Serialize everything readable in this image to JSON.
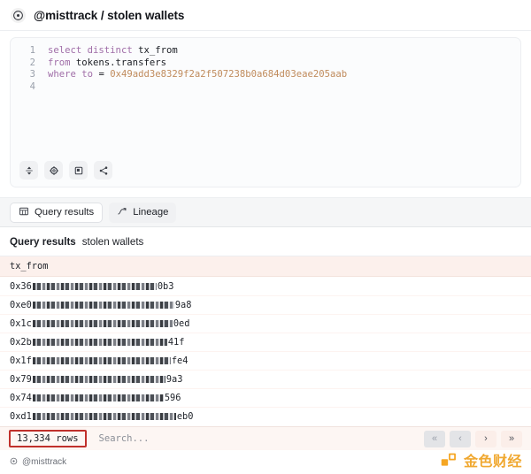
{
  "header": {
    "icon": "target-circle-icon",
    "title": "@misttrack / stolen wallets"
  },
  "editor": {
    "lines": [
      {
        "num": "1",
        "tokens": [
          {
            "t": "select",
            "c": "kw"
          },
          {
            "t": " ",
            "c": "plain"
          },
          {
            "t": "distinct",
            "c": "kw"
          },
          {
            "t": " ",
            "c": "plain"
          },
          {
            "t": "tx_from",
            "c": "ident"
          }
        ]
      },
      {
        "num": "2",
        "tokens": [
          {
            "t": "from",
            "c": "kw"
          },
          {
            "t": " ",
            "c": "plain"
          },
          {
            "t": "tokens.transfers",
            "c": "ident"
          }
        ]
      },
      {
        "num": "3",
        "tokens": [
          {
            "t": "where",
            "c": "kw"
          },
          {
            "t": " ",
            "c": "plain"
          },
          {
            "t": "to",
            "c": "kw"
          },
          {
            "t": " ",
            "c": "plain"
          },
          {
            "t": "=",
            "c": "ident"
          },
          {
            "t": " ",
            "c": "plain"
          },
          {
            "t": "0x49add3e8329f2a2f507238b0a684d03eae205aab",
            "c": "lit"
          }
        ]
      },
      {
        "num": "4",
        "tokens": []
      }
    ],
    "query_text": "select distinct tx_from\nfrom tokens.transfers\nwhere to = 0x49add3e8329f2a2f507238b0a684d03eae205aab",
    "toolbar": [
      {
        "name": "expand-collapse-icon",
        "label": "Expand / collapse"
      },
      {
        "name": "gear-icon",
        "label": "Settings"
      },
      {
        "name": "note-icon",
        "label": "Format / notes"
      },
      {
        "name": "share-icon",
        "label": "Share"
      }
    ]
  },
  "tabs": [
    {
      "label": "Query results",
      "icon": "table-icon",
      "active": true
    },
    {
      "label": "Lineage",
      "icon": "lineage-icon",
      "active": false
    }
  ],
  "results": {
    "title": "Query results",
    "subtitle": "stolen wallets",
    "column_header": "tx_from",
    "rows": [
      {
        "prefix": "0x36",
        "redacted_width": 140,
        "suffix": "0b3"
      },
      {
        "prefix": "0xe0",
        "redacted_width": 160,
        "suffix": "9a8"
      },
      {
        "prefix": "0x1c",
        "redacted_width": 158,
        "suffix": "0ed"
      },
      {
        "prefix": "0x2b",
        "redacted_width": 152,
        "suffix": "41f"
      },
      {
        "prefix": "0x1f",
        "redacted_width": 156,
        "suffix": "fe4"
      },
      {
        "prefix": "0x79",
        "redacted_width": 150,
        "suffix": "9a3"
      },
      {
        "prefix": "0x74",
        "redacted_width": 148,
        "suffix": "596"
      },
      {
        "prefix": "0xd1",
        "redacted_width": 162,
        "suffix": "eb0"
      }
    ]
  },
  "footer": {
    "rows_count": "13,334 rows",
    "search_placeholder": "Search...",
    "pagination": [
      {
        "glyph": "«",
        "name": "first-page-button",
        "state": "disabled"
      },
      {
        "glyph": "‹",
        "name": "prev-page-button",
        "state": "disabled"
      },
      {
        "glyph": "›",
        "name": "next-page-button",
        "state": "enabled"
      },
      {
        "glyph": "»",
        "name": "last-page-button",
        "state": "enabled"
      }
    ]
  },
  "bottom": {
    "handle": "@misttrack",
    "watermark_text": "金色财经"
  },
  "colors": {
    "keyword": "#a06ea8",
    "literal": "#c08b5c",
    "header_row_bg": "#fcf0ec",
    "footer_bg": "#fdf6f3",
    "annotation_red": "#c0302b",
    "watermark_orange": "#f0a830"
  }
}
